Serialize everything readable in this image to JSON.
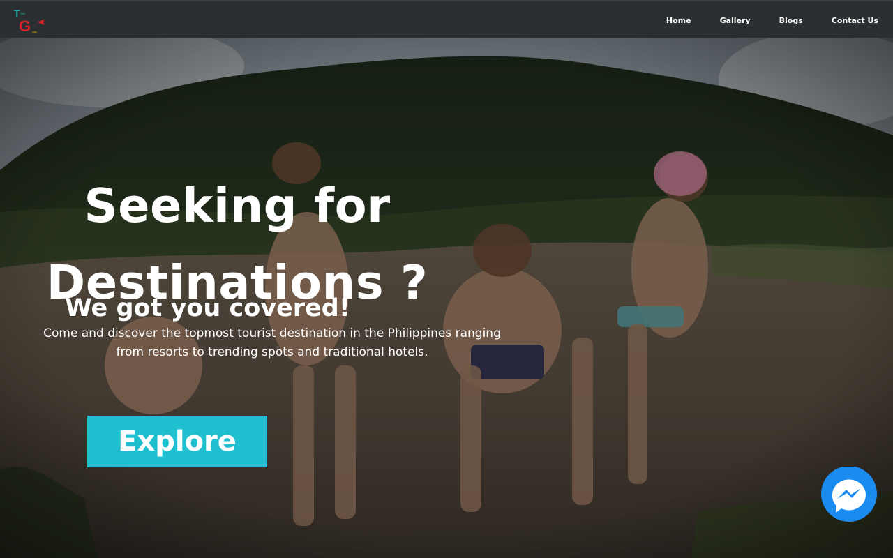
{
  "nav": {
    "logo_icon": "tourgala-logo-icon",
    "links": [
      {
        "label": "Home"
      },
      {
        "label": "Gallery"
      },
      {
        "label": "Blogs"
      },
      {
        "label": "Contact Us"
      }
    ]
  },
  "hero": {
    "heading": "Seeking for Destinations ?",
    "subheading": "We got you covered!",
    "description": "Come and discover the topmost tourist destination in the Philippines ranging from resorts to trending spots and traditional hotels.",
    "explore_label": "Explore",
    "background": "group-of-hikers-on-rocky-hilltop-photo"
  },
  "colors": {
    "navbar": "#2b2f31",
    "accent": "#1fbfcf",
    "messenger": "#1a8cf0"
  },
  "chat": {
    "icon": "messenger-icon"
  }
}
